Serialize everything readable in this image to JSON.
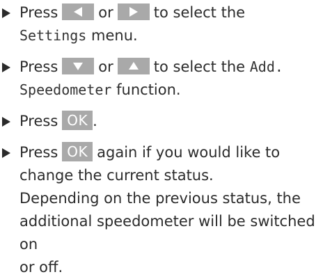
{
  "colors": {
    "text": "#2b2b2b",
    "key_background": "#a9a9a9",
    "key_text": "#ffffff"
  },
  "steps": [
    {
      "bullet_icon": "triangle-right",
      "press": "Press",
      "or": "or",
      "key_a": "left-arrow-key",
      "key_b": "right-arrow-key",
      "text_a": "to select the",
      "menu": "Settings",
      "text_b": "menu."
    },
    {
      "bullet_icon": "triangle-right",
      "press": "Press",
      "or": "or",
      "key_a": "down-arrow-key",
      "key_b": "up-arrow-key",
      "text_a": "to select the",
      "function_part1": "Add.",
      "function_part2": "Speedometer",
      "text_b": "function."
    },
    {
      "bullet_icon": "triangle-right",
      "press": "Press",
      "key": "OK",
      "end": "."
    },
    {
      "bullet_icon": "triangle-right",
      "press": "Press",
      "key": "OK",
      "text_line1": "again if you would like to",
      "text_line2": "change the current status.",
      "note_line1": "Depending on the previous status, the",
      "note_line2": "additional speedometer will be switched on",
      "note_line3": "or off."
    }
  ]
}
